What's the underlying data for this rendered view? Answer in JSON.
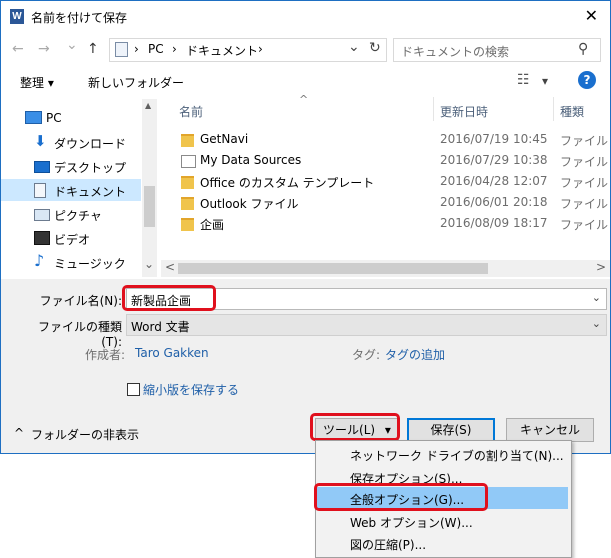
{
  "window": {
    "title": "名前を付けて保存",
    "close_glyph": "✕",
    "app_icon": "W"
  },
  "nav": {
    "back_icon": "←",
    "forward_icon": "→",
    "recent_icon": "⌄",
    "up_icon": "↑",
    "breadcrumb": [
      "PC",
      "ドキュメント"
    ],
    "sep": "›",
    "dropdown_icon": "⌄",
    "refresh_icon": "↻",
    "search_placeholder": "ドキュメントの検索",
    "search_icon": "⚲"
  },
  "commands": {
    "organize": "整理 ▾",
    "new_folder": "新しいフォルダー",
    "view_icon": "☷",
    "view_dropdown": "▾",
    "help": "?"
  },
  "sidebar": {
    "items": [
      {
        "label": "PC",
        "icon": "pc-icon"
      },
      {
        "label": "ダウンロード",
        "icon": "download-icon"
      },
      {
        "label": "デスクトップ",
        "icon": "desktop-icon"
      },
      {
        "label": "ドキュメント",
        "icon": "documents-icon",
        "selected": true
      },
      {
        "label": "ピクチャ",
        "icon": "pictures-icon"
      },
      {
        "label": "ビデオ",
        "icon": "video-icon"
      },
      {
        "label": "ミュージック",
        "icon": "music-icon"
      }
    ],
    "scroll_up": "▲",
    "scroll_down": "⌄"
  },
  "files": {
    "columns": [
      "名前",
      "更新日時",
      "種類"
    ],
    "sort_indicator": "^",
    "rows": [
      {
        "name": "GetNavi",
        "date": "2016/07/19 10:45",
        "type": "ファイル フォ"
      },
      {
        "name": "My Data Sources",
        "date": "2016/07/29 10:38",
        "type": "ファイル フォ"
      },
      {
        "name": "Office のカスタム テンプレート",
        "date": "2016/04/28 12:07",
        "type": "ファイル フォ"
      },
      {
        "name": "Outlook ファイル",
        "date": "2016/06/01 20:18",
        "type": "ファイル フォ"
      },
      {
        "name": "企画",
        "date": "2016/08/09 18:17",
        "type": "ファイル フォ"
      }
    ],
    "scroll_left": "<",
    "scroll_right": ">"
  },
  "form": {
    "filename_label": "ファイル名(N):",
    "filename_value": "新製品企画",
    "filetype_label": "ファイルの種類(T):",
    "filetype_value": "Word 文書",
    "author_label": "作成者:",
    "author_value": "Taro Gakken",
    "tags_label": "タグ:",
    "tags_value": "タグの追加",
    "thumbnail_label": "縮小版を保存する",
    "hide_folders": "フォルダーの非表示",
    "hide_icon": "^",
    "dropdown_icon": "⌄"
  },
  "buttons": {
    "tools": "ツール(L)",
    "tools_arrow": "▾",
    "save": "保存(S)",
    "cancel": "キャンセル"
  },
  "tools_menu": [
    "ネットワーク ドライブの割り当て(N)...",
    "保存オプション(S)...",
    "全般オプション(G)...",
    "Web オプション(W)...",
    "図の圧縮(P)..."
  ],
  "colors": {
    "highlight": "#e0101d",
    "selection": "#cce8ff",
    "menu_highlight": "#91c9f7",
    "accent": "#0078d7"
  }
}
